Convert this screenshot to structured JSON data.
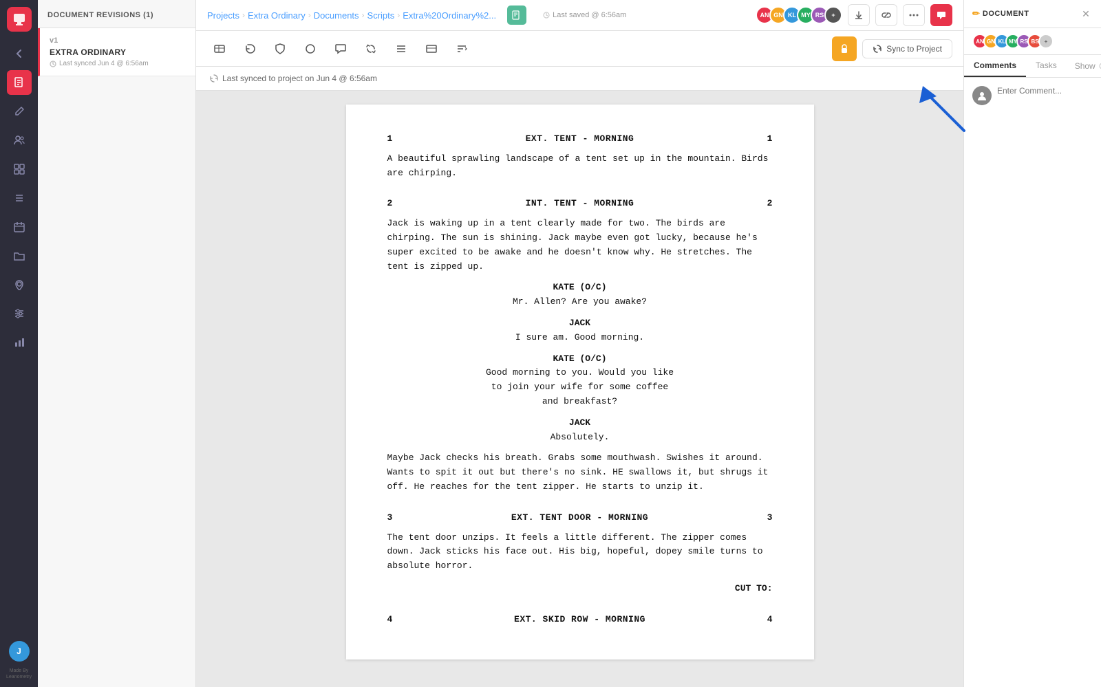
{
  "app": {
    "logo_char": "💬"
  },
  "sidebar": {
    "icons": [
      {
        "name": "back-arrow-icon",
        "char": "←",
        "active": false
      },
      {
        "name": "document-icon",
        "char": "▦",
        "active": true
      },
      {
        "name": "pencil-icon",
        "char": "✏️",
        "active": false
      },
      {
        "name": "people-icon",
        "char": "👤",
        "active": false
      },
      {
        "name": "board-icon",
        "char": "⊞",
        "active": false
      },
      {
        "name": "layers-icon",
        "char": "≡",
        "active": false
      },
      {
        "name": "calendar-icon",
        "char": "📅",
        "active": false
      },
      {
        "name": "folder-icon",
        "char": "📁",
        "active": false
      },
      {
        "name": "location-icon",
        "char": "📍",
        "active": false
      },
      {
        "name": "settings-icon",
        "char": "⚙",
        "active": false
      },
      {
        "name": "chart-icon",
        "char": "📊",
        "active": false
      }
    ],
    "made_by_label": "Made By",
    "made_by_brand": "Leanometry"
  },
  "revisions_panel": {
    "header": "Document Revisions (1)",
    "items": [
      {
        "version": "v1",
        "title": "EXTRA ORDINARY",
        "meta": "Last synced Jun 4 @ 6:56am"
      }
    ]
  },
  "topbar": {
    "breadcrumb": {
      "projects": "Projects",
      "extra_ordinary": "Extra Ordinary",
      "documents": "Documents",
      "scripts": "Scripts",
      "current": "Extra%20Ordinary%2..."
    },
    "save_info": "Last saved @ 6:56am",
    "avatars": [
      {
        "initials": "AN",
        "color": "#e8334a"
      },
      {
        "initials": "GN",
        "color": "#f5a623"
      },
      {
        "initials": "KL",
        "color": "#3498db"
      },
      {
        "initials": "MY",
        "color": "#27ae60"
      },
      {
        "initials": "RS",
        "color": "#9b59b6"
      }
    ],
    "toolbar_icons": [
      {
        "name": "download-icon",
        "char": "⬇"
      },
      {
        "name": "link-icon",
        "char": "🔗"
      },
      {
        "name": "more-icon",
        "char": "•••"
      },
      {
        "name": "chat-icon",
        "char": "💬"
      }
    ]
  },
  "toolbar": {
    "tools": [
      {
        "name": "scene-tool",
        "char": "⊿"
      },
      {
        "name": "back-tool",
        "char": "↩"
      },
      {
        "name": "shield-tool",
        "char": "🛡"
      },
      {
        "name": "circle-tool",
        "char": "○"
      },
      {
        "name": "comment-tool",
        "char": "💬"
      },
      {
        "name": "repeat-tool",
        "char": "↻"
      },
      {
        "name": "align-tool",
        "char": "≡"
      },
      {
        "name": "panel-tool",
        "char": "▭"
      },
      {
        "name": "sort-tool",
        "char": "⇅"
      }
    ],
    "lock_btn": "🔒",
    "sync_btn": "Sync to Project",
    "sync_icon": "↻"
  },
  "sync_notice": {
    "icon": "↻",
    "text": "Last synced to project on Jun 4 @ 6:56am"
  },
  "script": {
    "scenes": [
      {
        "number": "1",
        "heading": "EXT. TENT - MORNING",
        "description": "A beautiful sprawling landscape of a tent set up in the mountain. Birds are chirping."
      },
      {
        "number": "2",
        "heading": "INT. TENT - MORNING",
        "description": "Jack is waking up in a tent clearly made for two. The birds are chirping. The sun is shining. Jack maybe even got lucky, because he's super excited to be awake and he doesn't know why. He stretches. The tent is zipped up.",
        "dialogues": [
          {
            "character": "KATE (O/C)",
            "line": "Mr. Allen? Are you awake?"
          },
          {
            "character": "JACK",
            "line": "I sure am. Good morning."
          },
          {
            "character": "KATE (O/C)",
            "line": "Good morning to you. Would you like\nto join your wife for some coffee\nand breakfast?"
          },
          {
            "character": "JACK",
            "line": "Absolutely."
          }
        ],
        "action": "Maybe Jack checks his breath. Grabs some mouthwash. Swishes it around. Wants to spit it out but there's no sink. HE swallows it, but shrugs it off. He reaches for the tent zipper. He starts to unzip it."
      },
      {
        "number": "3",
        "heading": "EXT. TENT DOOR - MORNING",
        "description": "The tent door unzips. It feels a little different. The zipper comes down. Jack sticks his face out. His big, hopeful, dopey smile turns to absolute horror.",
        "cut_to": "CUT TO:"
      },
      {
        "number": "4",
        "heading": "EXT. SKID ROW - MORNING",
        "description": ""
      }
    ]
  },
  "right_panel": {
    "title": "✏ DOCUMENT",
    "tabs": {
      "comments": "Comments",
      "tasks": "Tasks",
      "show": "Show"
    },
    "comment_input_placeholder": "Enter Comment...",
    "avatars": [
      {
        "initials": "AN",
        "color": "#e8334a"
      },
      {
        "initials": "GN",
        "color": "#f5a623"
      },
      {
        "initials": "KL",
        "color": "#3498db"
      },
      {
        "initials": "MY",
        "color": "#27ae60"
      },
      {
        "initials": "RS",
        "color": "#9b59b6"
      },
      {
        "initials": "BS",
        "color": "#e74c3c"
      }
    ]
  }
}
